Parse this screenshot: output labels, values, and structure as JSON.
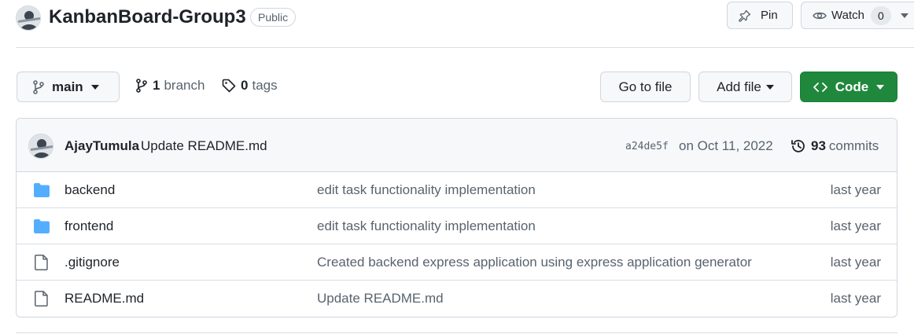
{
  "repo": {
    "name": "KanbanBoard-Group3",
    "visibility": "Public",
    "owner_avatar": "avatar-icon"
  },
  "actions": {
    "pin_label": "Pin",
    "watch_label": "Watch",
    "watch_count": "0"
  },
  "toolbar": {
    "branch": "main",
    "branch_count": "1",
    "branch_word": "branch",
    "tag_count": "0",
    "tag_word": "tags",
    "goto_file": "Go to file",
    "add_file": "Add file",
    "code": "Code"
  },
  "latest_commit": {
    "author": "AjayTumula",
    "message": "Update README.md",
    "sha": "a24de5f",
    "date": "on Oct 11, 2022",
    "commit_count": "93",
    "commit_word": "commits"
  },
  "files": [
    {
      "type": "folder",
      "name": "backend",
      "commit": "edit task functionality implementation",
      "age": "last year"
    },
    {
      "type": "folder",
      "name": "frontend",
      "commit": "edit task functionality implementation",
      "age": "last year"
    },
    {
      "type": "file",
      "name": ".gitignore",
      "commit": "Created backend express application using express application generator",
      "age": "last year"
    },
    {
      "type": "file",
      "name": "README.md",
      "commit": "Update README.md",
      "age": "last year"
    }
  ],
  "colors": {
    "accent_green": "#1f883d",
    "folder_blue": "#54aeff",
    "muted": "#59636e"
  }
}
